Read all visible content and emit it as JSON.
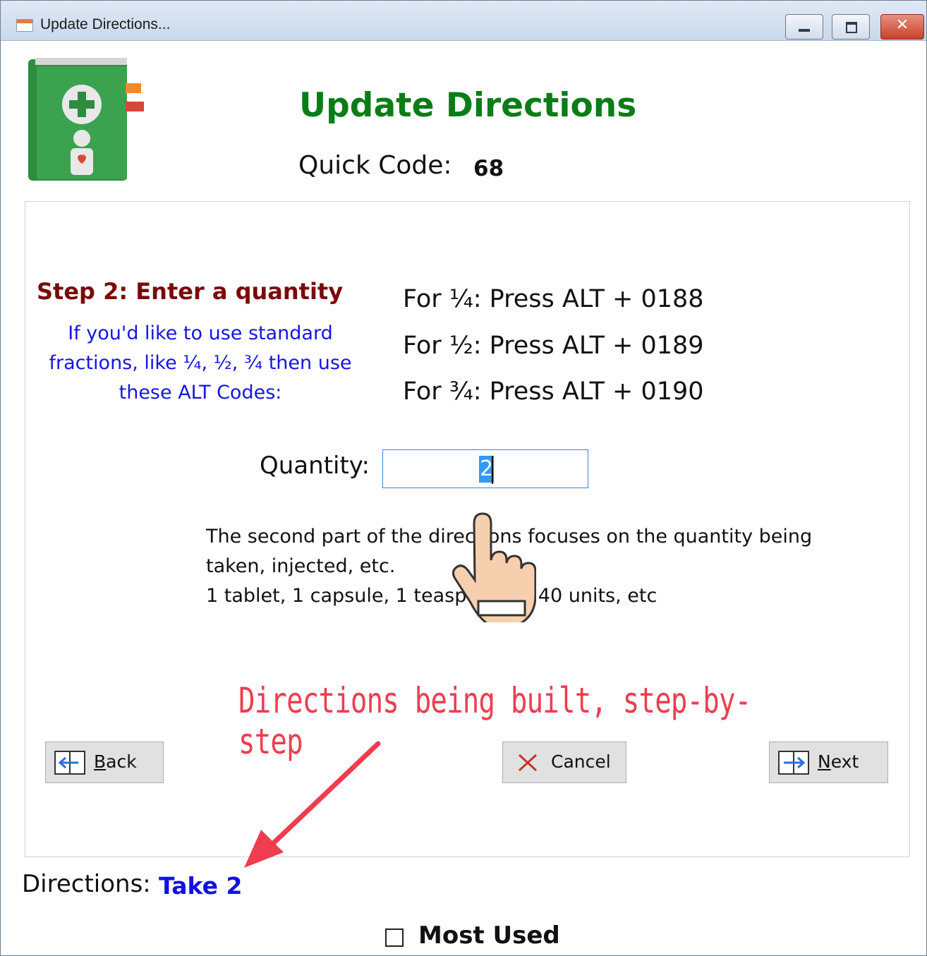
{
  "window": {
    "title": "Update Directions...",
    "controls": {
      "minimize": "minimize",
      "maximize": "maximize",
      "close": "✕"
    }
  },
  "header": {
    "title": "Update Directions",
    "quick_code_label": "Quick Code:",
    "quick_code_value": "68",
    "logo_icon": "medical-book-icon"
  },
  "step": {
    "title": "Step 2: Enter a quantity",
    "help": "If you'd like to use standard fractions, like ¼, ½, ¾ then use these ALT Codes:",
    "alt_codes": [
      "For ¼: Press ALT + 0188",
      "For ½: Press ALT + 0189",
      "For ¾: Press ALT + 0190"
    ]
  },
  "quantity": {
    "label": "Quantity:",
    "value": "2"
  },
  "description": {
    "line1": "The second part of the directions focuses on the quantity being",
    "line2": "taken, injected, etc.",
    "line3": "1 tablet, 1 capsule, 1 teaspoonful, 40 units, etc"
  },
  "annotation": {
    "text": "Directions being built, step-by-step",
    "color": "#ee3d4e"
  },
  "buttons": {
    "back": {
      "mnemonic": "B",
      "rest": "ack"
    },
    "cancel": "Cancel",
    "next": {
      "mnemonic": "N",
      "rest": "ext"
    }
  },
  "directions": {
    "label": "Directions:",
    "value": "Take 2"
  },
  "most_used": {
    "label": "Most Used",
    "checked": false
  },
  "colors": {
    "heading": "#0a7d16",
    "step_title": "#7a0a0a",
    "help": "#1515e0",
    "directions_value": "#1010e8"
  }
}
